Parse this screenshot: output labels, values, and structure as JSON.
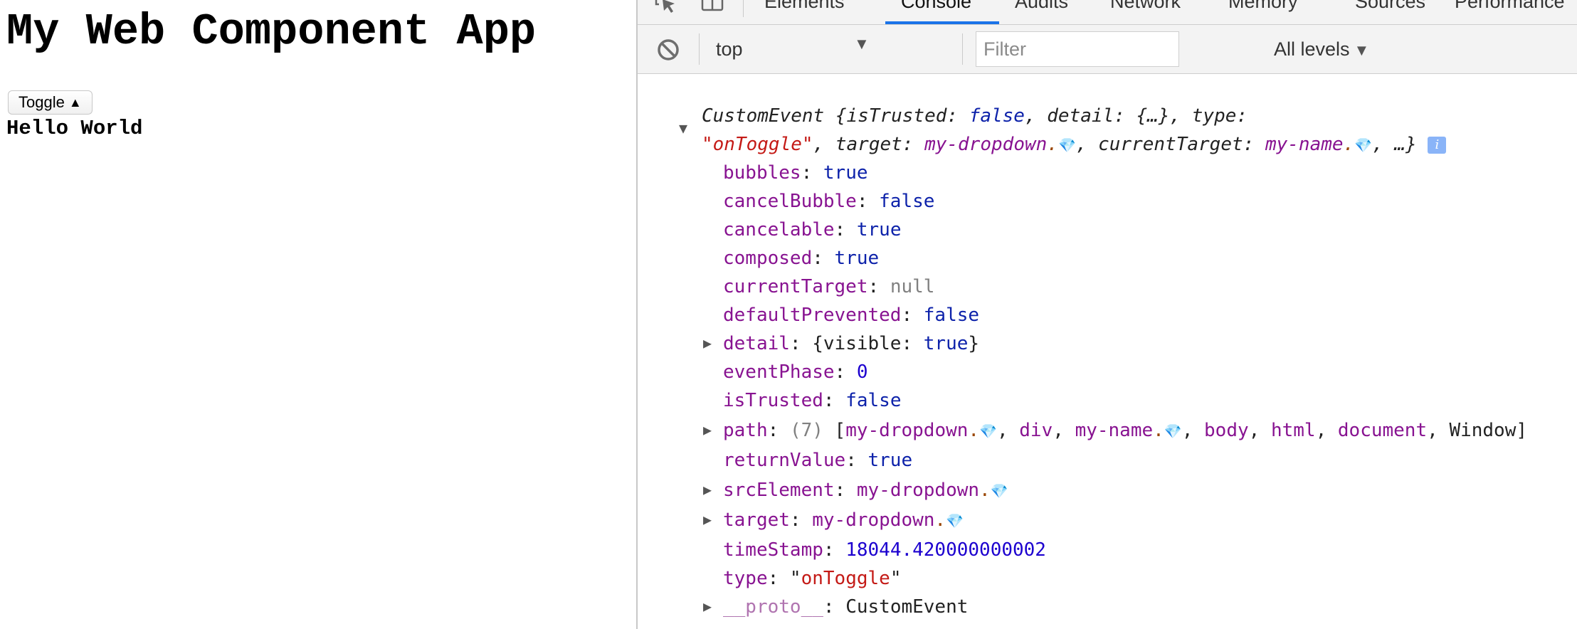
{
  "page": {
    "title": "My Web Component App",
    "toggle_label": "Toggle",
    "toggle_arrow": "▲",
    "hello": "Hello World"
  },
  "devtools": {
    "tabs": [
      "Elements",
      "Console",
      "Audits",
      "Network",
      "Memory",
      "Sources",
      "Performance"
    ],
    "active_tab": "Console",
    "context": "top",
    "filter_placeholder": "Filter",
    "levels": "All levels"
  },
  "console": {
    "header": {
      "class_name": "CustomEvent",
      "line1_rest": " {isTrusted: ",
      "is_trusted_val": "false",
      "line1_b": ", detail: {…}, type:",
      "type_val": "\"onToggle\"",
      "line2_b": ", target: ",
      "target_node": "my-dropdown",
      "line2_c": ", currentTarget: ",
      "current_node": "my-name",
      "line2_d": ", …}",
      "info": "i"
    },
    "props": {
      "bubbles": {
        "key": "bubbles",
        "val": "true"
      },
      "cancelBubble": {
        "key": "cancelBubble",
        "val": "false"
      },
      "cancelable": {
        "key": "cancelable",
        "val": "true"
      },
      "composed": {
        "key": "composed",
        "val": "true"
      },
      "currentTarget": {
        "key": "currentTarget",
        "val": "null"
      },
      "defaultPrevented": {
        "key": "defaultPrevented",
        "val": "false"
      },
      "detail": {
        "key": "detail",
        "pre": "{visible: ",
        "val": "true",
        "post": "}"
      },
      "eventPhase": {
        "key": "eventPhase",
        "val": "0"
      },
      "isTrusted": {
        "key": "isTrusted",
        "val": "false"
      },
      "path": {
        "key": "path",
        "count": "(7)",
        "items": [
          "my-dropdown",
          "div",
          "my-name",
          "body",
          "html",
          "document",
          "Window"
        ]
      },
      "returnValue": {
        "key": "returnValue",
        "val": "true"
      },
      "srcElement": {
        "key": "srcElement",
        "val": "my-dropdown"
      },
      "target": {
        "key": "target",
        "val": "my-dropdown"
      },
      "timeStamp": {
        "key": "timeStamp",
        "val": "18044.420000000002"
      },
      "type": {
        "key": "type",
        "val": "onToggle"
      },
      "proto": {
        "key": "__proto__",
        "val": "CustomEvent"
      }
    }
  }
}
